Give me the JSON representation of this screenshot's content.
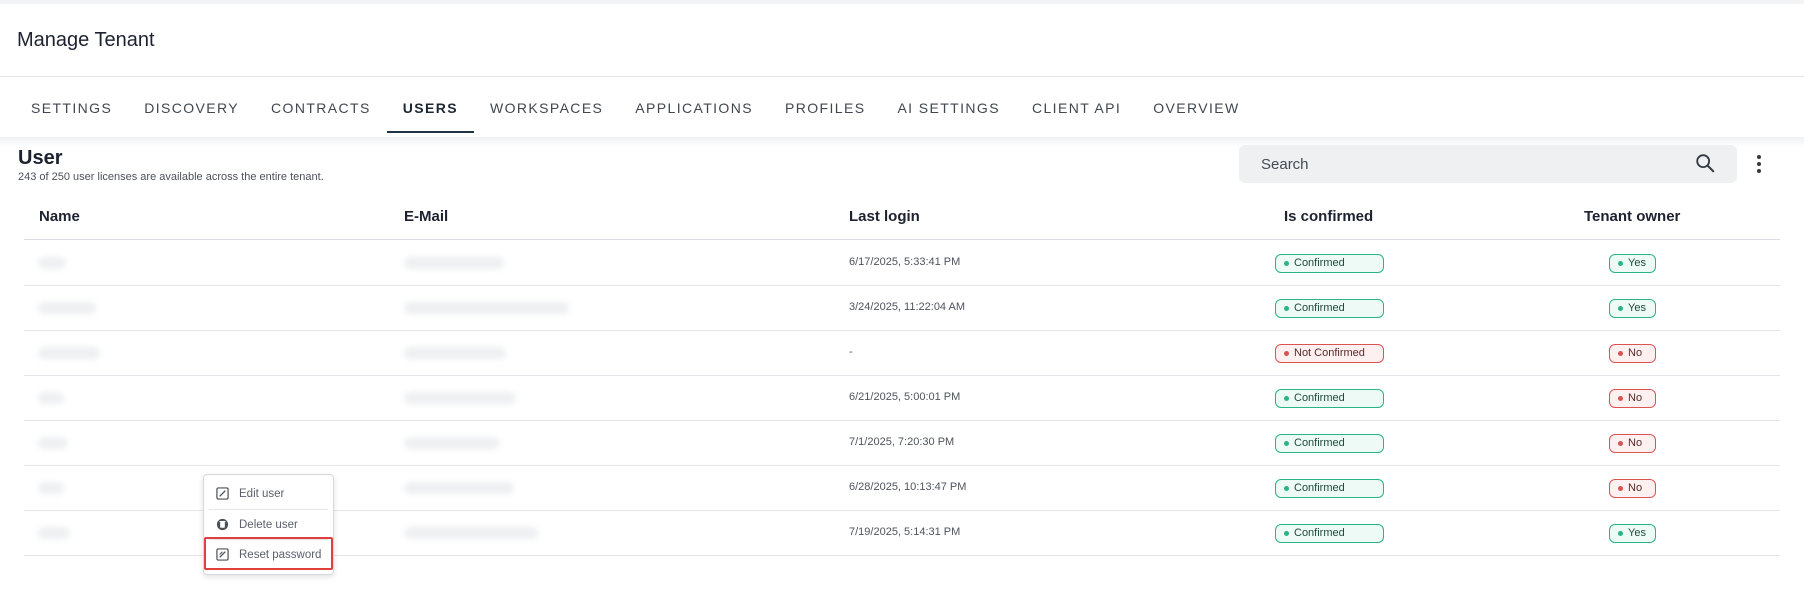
{
  "page": {
    "title": "Manage Tenant"
  },
  "tabs": [
    {
      "label": "SETTINGS",
      "active": false
    },
    {
      "label": "DISCOVERY",
      "active": false
    },
    {
      "label": "CONTRACTS",
      "active": false
    },
    {
      "label": "USERS",
      "active": true
    },
    {
      "label": "WORKSPACES",
      "active": false
    },
    {
      "label": "APPLICATIONS",
      "active": false
    },
    {
      "label": "PROFILES",
      "active": false
    },
    {
      "label": "AI SETTINGS",
      "active": false
    },
    {
      "label": "CLIENT API",
      "active": false
    },
    {
      "label": "OVERVIEW",
      "active": false
    }
  ],
  "section": {
    "title": "User",
    "subtitle": "243 of 250 user licenses are available across the entire tenant.",
    "search_placeholder": "Search"
  },
  "table": {
    "columns": [
      "Name",
      "E-Mail",
      "Last login",
      "Is confirmed",
      "Tenant owner"
    ],
    "rows": [
      {
        "last_login": "6/17/2025, 5:33:41 PM",
        "confirmed": "Confirmed",
        "confirmed_ok": true,
        "owner": "Yes",
        "owner_ok": true
      },
      {
        "last_login": "3/24/2025, 11:22:04 AM",
        "confirmed": "Confirmed",
        "confirmed_ok": true,
        "owner": "Yes",
        "owner_ok": true
      },
      {
        "last_login": "-",
        "confirmed": "Not Confirmed",
        "confirmed_ok": false,
        "owner": "No",
        "owner_ok": false
      },
      {
        "last_login": "6/21/2025, 5:00:01 PM",
        "confirmed": "Confirmed",
        "confirmed_ok": true,
        "owner": "No",
        "owner_ok": false
      },
      {
        "last_login": "7/1/2025, 7:20:30 PM",
        "confirmed": "Confirmed",
        "confirmed_ok": true,
        "owner": "No",
        "owner_ok": false
      },
      {
        "last_login": "6/28/2025, 10:13:47 PM",
        "confirmed": "Confirmed",
        "confirmed_ok": true,
        "owner": "No",
        "owner_ok": false
      },
      {
        "last_login": "7/19/2025, 5:14:31 PM",
        "confirmed": "Confirmed",
        "confirmed_ok": true,
        "owner": "Yes",
        "owner_ok": true
      }
    ]
  },
  "context_menu": {
    "items": [
      {
        "label": "Edit user",
        "icon": "edit-icon"
      },
      {
        "label": "Delete user",
        "icon": "trash-icon"
      },
      {
        "label": "Reset password",
        "icon": "reset-password-icon"
      }
    ]
  },
  "colors": {
    "accent": "#1f3444",
    "confirmed": "#28b487",
    "not_confirmed": "#d9534f",
    "highlight": "#e0403c"
  }
}
